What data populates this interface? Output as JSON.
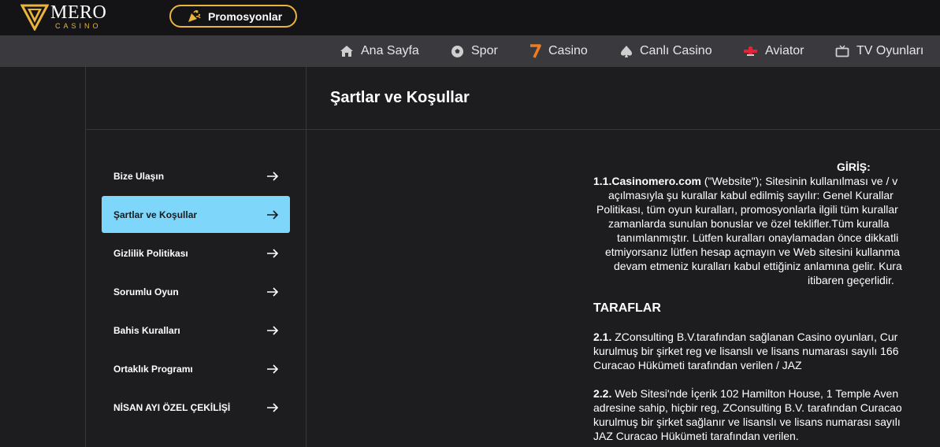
{
  "header": {
    "logo_text": "MERO",
    "logo_sub": "CASINO",
    "promo_label": "Promosyonlar"
  },
  "nav": [
    {
      "label": "Ana Sayfa",
      "icon": "home-icon"
    },
    {
      "label": "Spor",
      "icon": "soccer-ball-icon"
    },
    {
      "label": "Casino",
      "icon": "seven-icon"
    },
    {
      "label": "Canlı Casino",
      "icon": "spade-icon"
    },
    {
      "label": "Aviator",
      "icon": "plane-icon"
    },
    {
      "label": "TV Oyunları",
      "icon": "tv-icon"
    }
  ],
  "page_title": "Şartlar ve Koşullar",
  "sidebar": [
    {
      "label": "Bize Ulaşın",
      "active": false
    },
    {
      "label": "Şartlar ve Koşullar",
      "active": true
    },
    {
      "label": "Gizlilik Politikası",
      "active": false
    },
    {
      "label": "Sorumlu Oyun",
      "active": false
    },
    {
      "label": "Bahis Kuralları",
      "active": false
    },
    {
      "label": "Ortaklık Programı",
      "active": false
    },
    {
      "label": "NİSAN AYI ÖZEL ÇEKİLİŞİ",
      "active": false
    }
  ],
  "terms": {
    "intro_heading": "GİRİŞ:",
    "intro_bold": "1.1.Casinomero.com",
    "intro_line1": " (\"Website\"); Sitesinin kullanılması ve / v",
    "intro_lines": [
      "açılmasıyla şu kurallar kabul edilmiş sayılır: Genel Kurallar",
      "Politikası, tüm oyun kuralları, promosyonlarla ilgili tüm kurallar",
      "zamanlarda sunulan bonuslar ve özel teklifler.Tüm kuralla",
      "tanımlanmıştır. Lütfen kuralları onaylamadan önce dikkatli",
      "etmiyorsanız lütfen hesap açmayın ve Web sitesini kullanma",
      "devam etmeniz kuralları kabul ettiğiniz anlamına gelir. Kura",
      "itibaren geçerlidir."
    ],
    "section_heading": "TARAFLAR",
    "s21_num": "2.1.",
    "s21_lines": [
      " ZConsulting B.V.tarafından sağlanan Casino oyunları, Cur",
      "kurulmuş bir şirket reg ve lisanslı ve lisans numarası sayılı 166",
      "Curacao Hükümeti tarafından verilen / JAZ"
    ],
    "s22_num": "2.2.",
    "s22_lines": [
      " Web Sitesi'nde İçerik 102 Hamilton House, 1 Temple Aven",
      "adresine sahip, hiçbir reg, ZConsulting B.V. tarafından Curacao",
      "kurulmuş bir şirket sağlanır ve lisanslı ve lisans numarası sayılı",
      "JAZ Curacao Hükümeti tarafından verilen."
    ]
  },
  "colors": {
    "accent_gold": "#e9b53a",
    "active_item": "#7fd6fb",
    "casino_seven": "#f07c22",
    "aviator_red": "#e0243b"
  }
}
